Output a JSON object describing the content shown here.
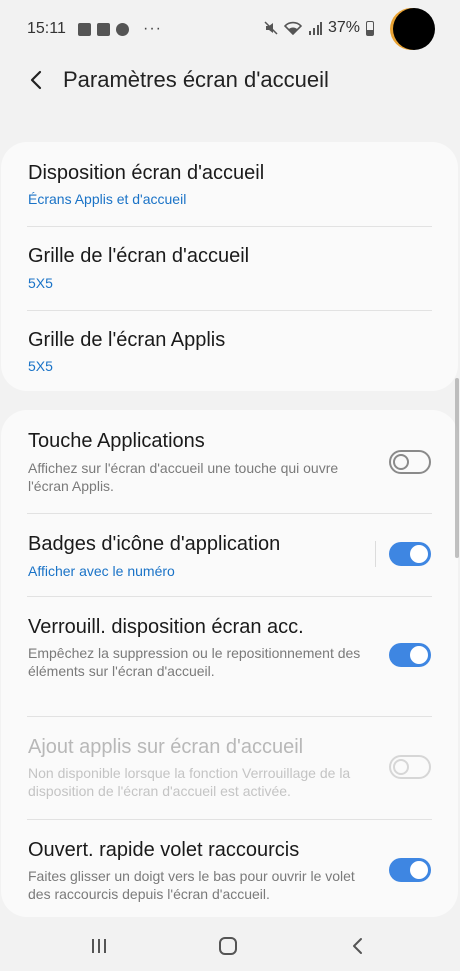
{
  "status_bar": {
    "time": "15:11",
    "battery": "37%",
    "overflow": "···",
    "icons_left": [
      "gallery-icon",
      "image-icon",
      "basketball-icon"
    ],
    "icons_right": [
      "mute-icon",
      "wifi-icon",
      "signal-icon",
      "battery-icon"
    ]
  },
  "header": {
    "title": "Paramètres écran d'accueil"
  },
  "card1": {
    "items": [
      {
        "title": "Disposition écran d'accueil",
        "sub": "Écrans Applis et d'accueil"
      },
      {
        "title": "Grille de l'écran d'accueil",
        "sub": "5X5"
      },
      {
        "title": "Grille de l'écran Applis",
        "sub": "5X5"
      }
    ]
  },
  "card2": {
    "items": [
      {
        "title": "Touche Applications",
        "desc": "Affichez sur l'écran d'accueil une touche qui ouvre l'écran Applis.",
        "toggle": false
      },
      {
        "title": "Badges d'icône d'application",
        "sub": "Afficher avec le numéro",
        "toggle": true
      },
      {
        "title": "Verrouill. disposition écran acc.",
        "desc": "Empêchez la suppression ou le repositionnement des éléments sur l'écran d'accueil.",
        "toggle": true
      },
      {
        "title": "Ajout applis sur écran d'accueil",
        "desc": "Non disponible lorsque la fonction Verrouillage de la disposition de l'écran d'accueil est activée.",
        "toggle": false,
        "disabled": true
      },
      {
        "title": "Ouvert. rapide volet raccourcis",
        "desc": "Faites glisser un doigt vers le bas pour ouvrir le volet des raccourcis depuis l'écran d'accueil.",
        "toggle": true
      }
    ]
  },
  "colors": {
    "accent": "#3e86e2",
    "link": "#1a73c7",
    "background": "#f2f2f2",
    "card": "#fafafa"
  },
  "navbar": {
    "buttons": [
      "recents-icon",
      "home-icon",
      "back-icon"
    ]
  }
}
